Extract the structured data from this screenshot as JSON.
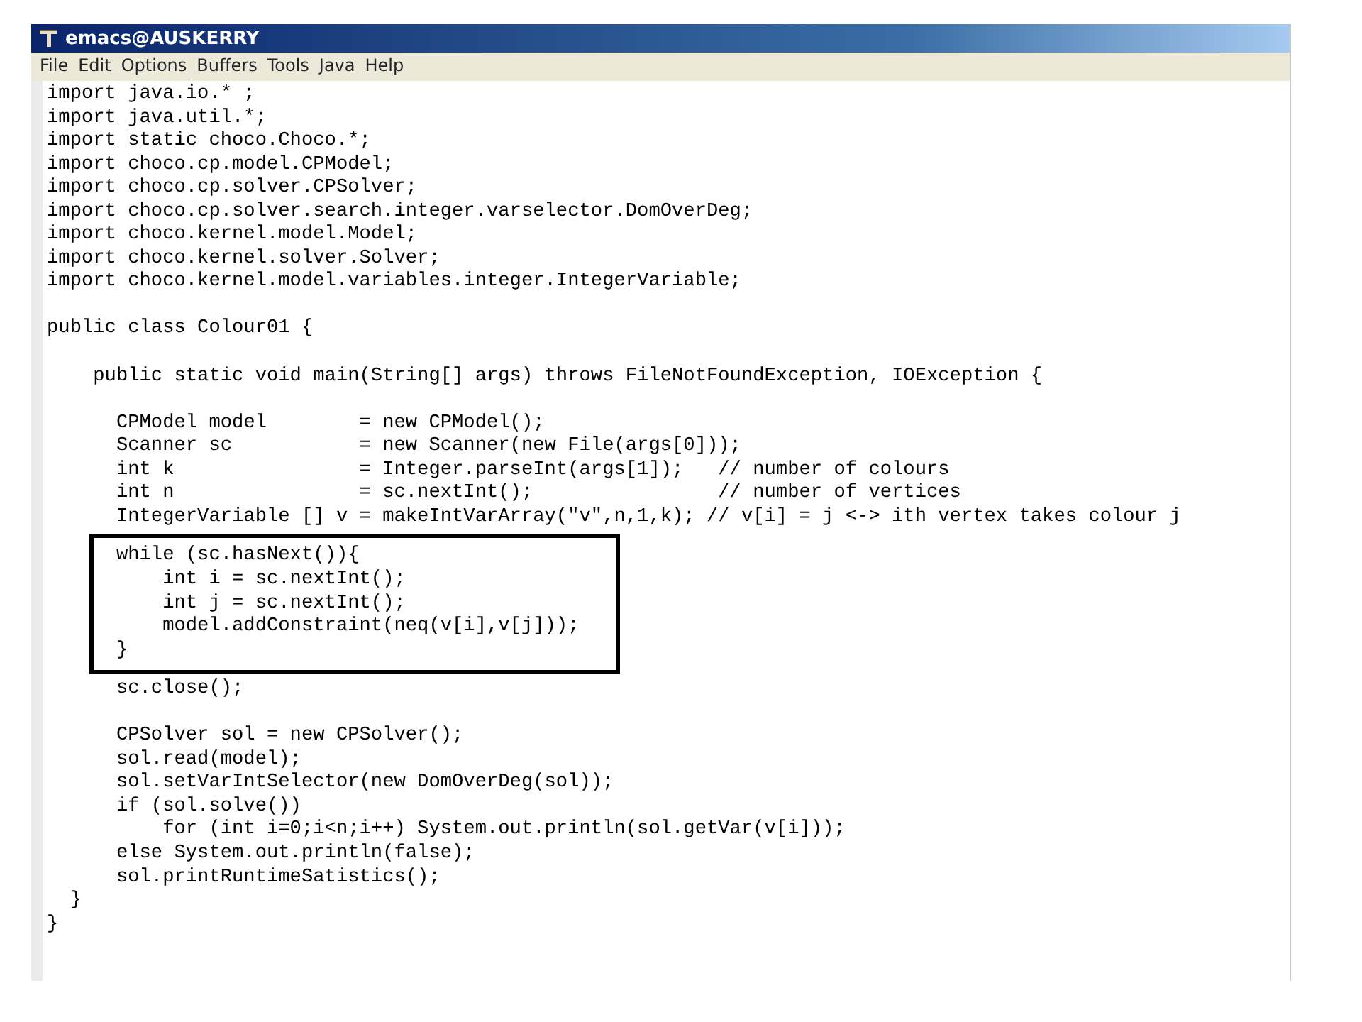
{
  "window": {
    "title": "emacs@AUSKERRY"
  },
  "menu": [
    "File",
    "Edit",
    "Options",
    "Buffers",
    "Tools",
    "Java",
    "Help"
  ],
  "code_blocks": [
    {
      "boxed": false,
      "lines": [
        "import java.io.* ;",
        "import java.util.*;",
        "import static choco.Choco.*;",
        "import choco.cp.model.CPModel;",
        "import choco.cp.solver.CPSolver;",
        "import choco.cp.solver.search.integer.varselector.DomOverDeg;",
        "import choco.kernel.model.Model;",
        "import choco.kernel.solver.Solver;",
        "import choco.kernel.model.variables.integer.IntegerVariable;"
      ]
    },
    {
      "boxed": false,
      "lines": [
        "public class Colour01 {"
      ]
    },
    {
      "boxed": false,
      "lines": [
        "    public static void main(String[] args) throws FileNotFoundException, IOException {"
      ]
    },
    {
      "boxed": false,
      "lines": [
        "      CPModel model        = new CPModel();",
        "      Scanner sc           = new Scanner(new File(args[0]));",
        "      int k                = Integer.parseInt(args[1]);   // number of colours",
        "      int n                = sc.nextInt();                // number of vertices",
        "      IntegerVariable [] v = makeIntVarArray(\"v\",n,1,k); // v[i] = j <-> ith vertex takes colour j"
      ]
    },
    {
      "boxed": true,
      "lines": [
        "      while (sc.hasNext()){",
        "          int i = sc.nextInt();",
        "          int j = sc.nextInt();",
        "          model.addConstraint(neq(v[i],v[j]));",
        "      }"
      ]
    },
    {
      "boxed": false,
      "lines": [
        "      sc.close();"
      ]
    },
    {
      "boxed": false,
      "lines": [
        "      CPSolver sol = new CPSolver();",
        "      sol.read(model);",
        "      sol.setVarIntSelector(new DomOverDeg(sol));",
        "      if (sol.solve())",
        "          for (int i=0;i<n;i++) System.out.println(sol.getVar(v[i]));",
        "      else System.out.println(false);",
        "      sol.printRuntimeSatistics();",
        "  }",
        "}"
      ]
    }
  ]
}
